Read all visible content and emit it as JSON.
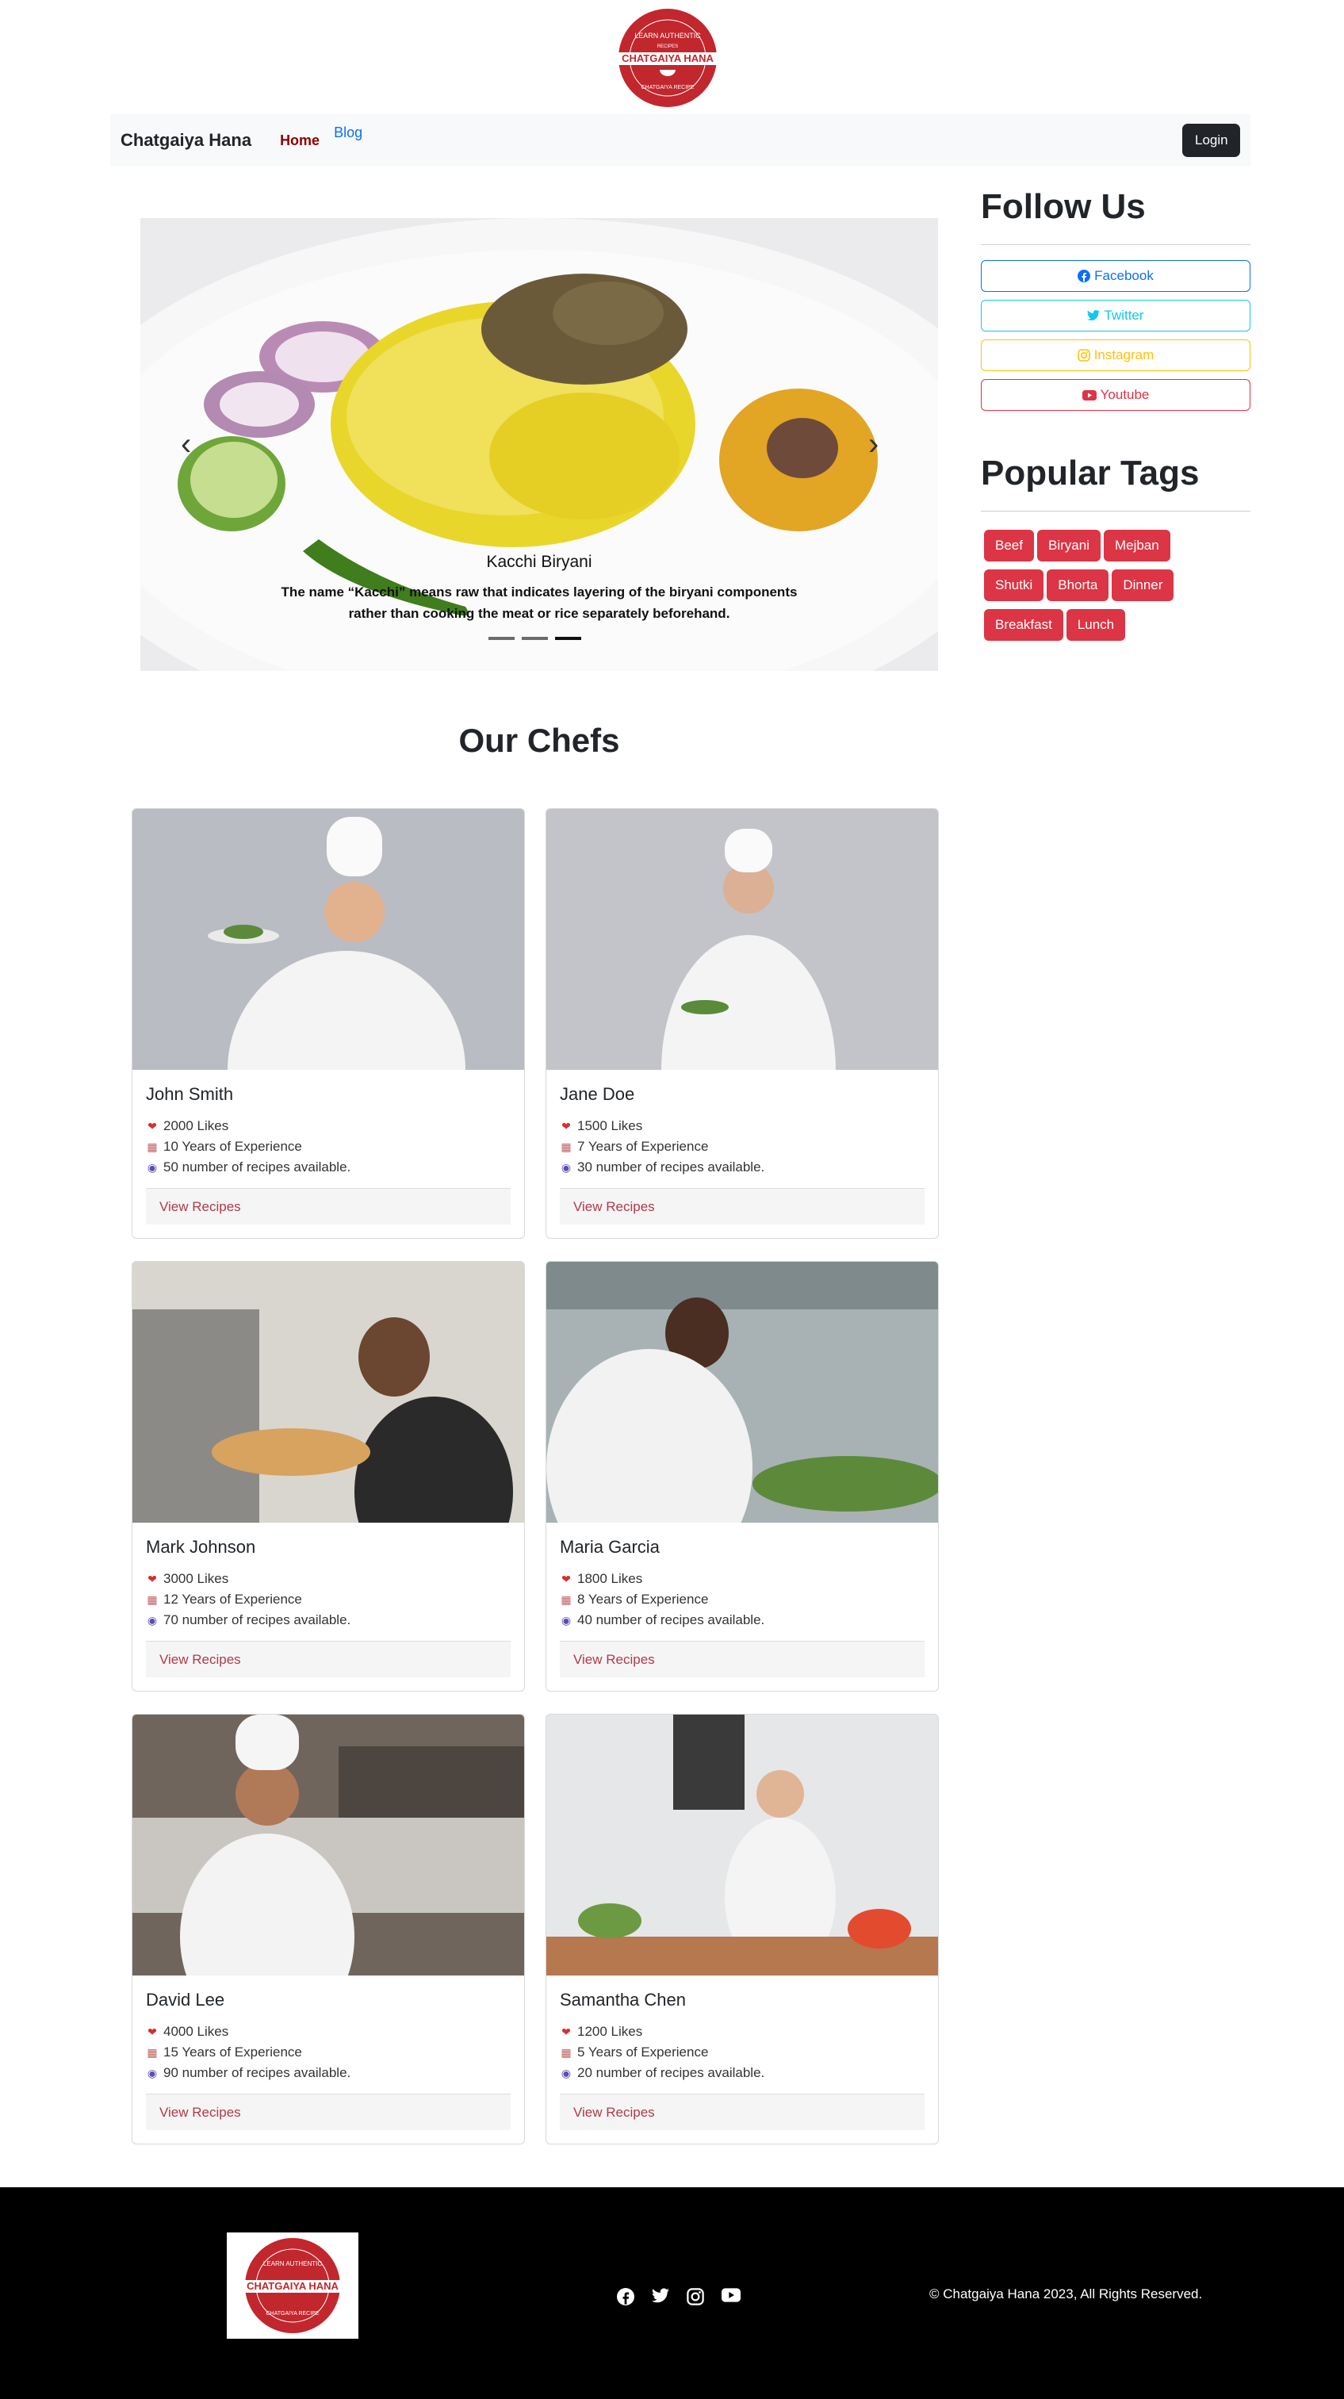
{
  "logo": {
    "top_ring_text": "LEARN AUTHENTIC",
    "middle_small_text": "RECIPES",
    "brand_text": "CHATGAIYA HANA",
    "bottom_ring_text": "CHATGAIYA RECIPE"
  },
  "navbar": {
    "brand": "Chatgaiya Hana",
    "links": [
      "Home",
      "Blog"
    ],
    "login_label": "Login"
  },
  "carousel": {
    "slide_title": "Kacchi Biryani",
    "slide_text": "The name “Kacchi” means raw that indicates layering of the biryani components rather than cooking the meat or rice separately beforehand.",
    "slide_count": 3,
    "active_slide": 3,
    "prev_icon": "chevron-left-icon",
    "next_icon": "chevron-right-icon"
  },
  "sidebar": {
    "follow_title": "Follow Us",
    "social": [
      {
        "label": "Facebook",
        "icon": "facebook-icon",
        "color": "#0d6efd"
      },
      {
        "label": "Twitter",
        "icon": "twitter-icon",
        "color": "#0dcaf0"
      },
      {
        "label": "Instagram",
        "icon": "instagram-icon",
        "color": "#ffc107"
      },
      {
        "label": "Youtube",
        "icon": "youtube-icon",
        "color": "#dc3545"
      }
    ],
    "tags_title": "Popular Tags",
    "tags": [
      "Beef",
      "Biryani",
      "Mejban",
      "Shutki",
      "Bhorta",
      "Dinner",
      "Breakfast",
      "Lunch"
    ]
  },
  "chefs": {
    "title": "Our Chefs",
    "view_label": "View Recipes",
    "items": [
      {
        "name": "John Smith",
        "likes": "2000 Likes",
        "experience": "10 Years of Experience",
        "recipes": "50 number of recipes available."
      },
      {
        "name": "Jane Doe",
        "likes": "1500 Likes",
        "experience": "7 Years of Experience",
        "recipes": "30 number of recipes available."
      },
      {
        "name": "Mark Johnson",
        "likes": "3000 Likes",
        "experience": "12 Years of Experience",
        "recipes": "70 number of recipes available."
      },
      {
        "name": "Maria Garcia",
        "likes": "1800 Likes",
        "experience": "8 Years of Experience",
        "recipes": "40 number of recipes available."
      },
      {
        "name": "David Lee",
        "likes": "4000 Likes",
        "experience": "15 Years of Experience",
        "recipes": "90 number of recipes available."
      },
      {
        "name": "Samantha Chen",
        "likes": "1200 Likes",
        "experience": "5 Years of Experience",
        "recipes": "20 number of recipes available."
      }
    ]
  },
  "footer": {
    "copyright": "© Chatgaiya Hana 2023, All Rights Reserved.",
    "icons": [
      "facebook-icon",
      "twitter-icon",
      "instagram-icon",
      "youtube-icon"
    ]
  },
  "colors": {
    "brand_red": "#c1272d",
    "danger": "#dc3545",
    "dark": "#212529",
    "link_red": "#b23a48"
  }
}
